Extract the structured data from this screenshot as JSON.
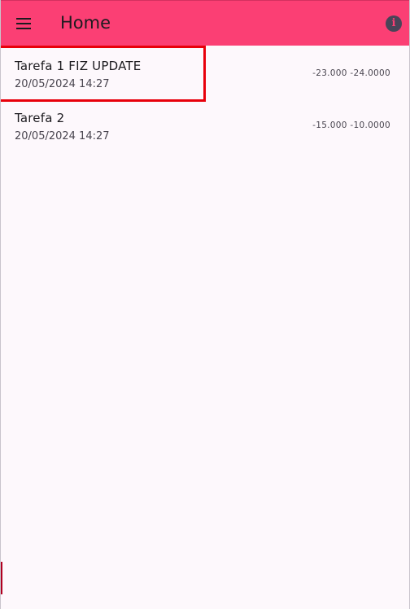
{
  "appbar": {
    "title": "Home",
    "menu_icon": "menu-icon",
    "info_icon": "info-icon"
  },
  "list": {
    "items": [
      {
        "title": "Tarefa 1 FIZ UPDATE",
        "date": "20/05/2024 14:27",
        "coords": "-23.000 -24.0000"
      },
      {
        "title": "Tarefa 2",
        "date": "20/05/2024 14:27",
        "coords": "-15.000 -10.0000"
      }
    ]
  },
  "colors": {
    "appbar": "#fb3f74",
    "background": "#fdf8fc",
    "highlight_border": "#e8000b"
  }
}
